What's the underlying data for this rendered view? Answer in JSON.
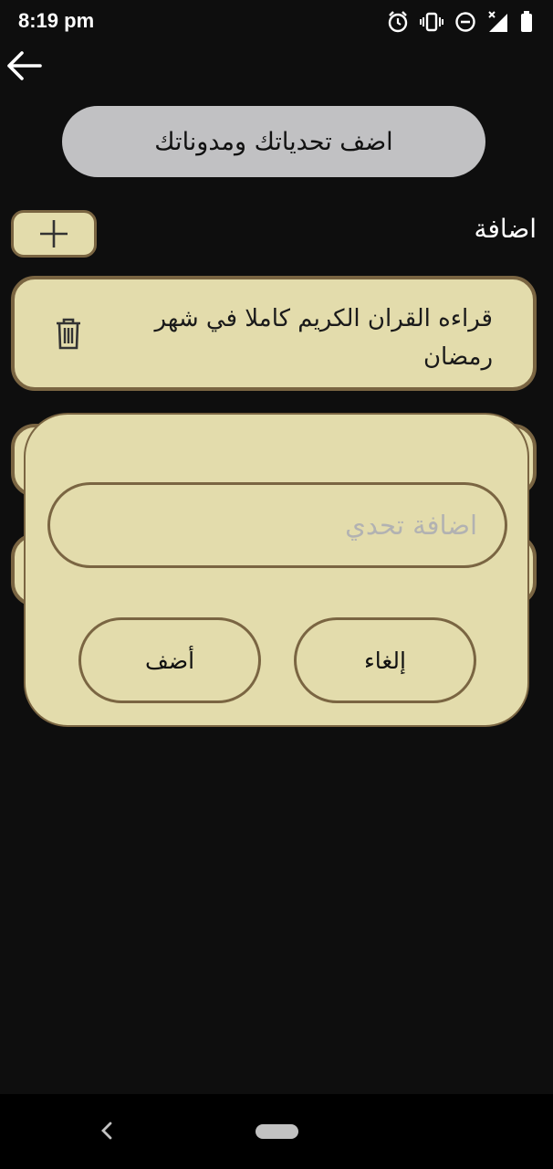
{
  "status_bar": {
    "time": "8:19 pm",
    "icons": [
      "alarm-icon",
      "vibrate-icon",
      "do-not-disturb-icon",
      "signal-icon",
      "battery-icon"
    ]
  },
  "header": {
    "back_icon": "arrow-left-icon",
    "title": "اضف تحدياتك ومدوناتك"
  },
  "add_section": {
    "label": "اضافة",
    "button_icon": "plus-icon"
  },
  "challenges": [
    {
      "text": "قراءه القران الكريم كاملا في شهر رمضان",
      "delete_icon": "trash-icon"
    }
  ],
  "dialog": {
    "input_value": "",
    "input_placeholder": "اضافة تحدي",
    "add_label": "أضف",
    "cancel_label": "إلغاء"
  },
  "colors": {
    "background": "#0e0e0e",
    "card": "#e3dcac",
    "card_border": "#7a6542",
    "header_pill": "#c1c1c3"
  }
}
